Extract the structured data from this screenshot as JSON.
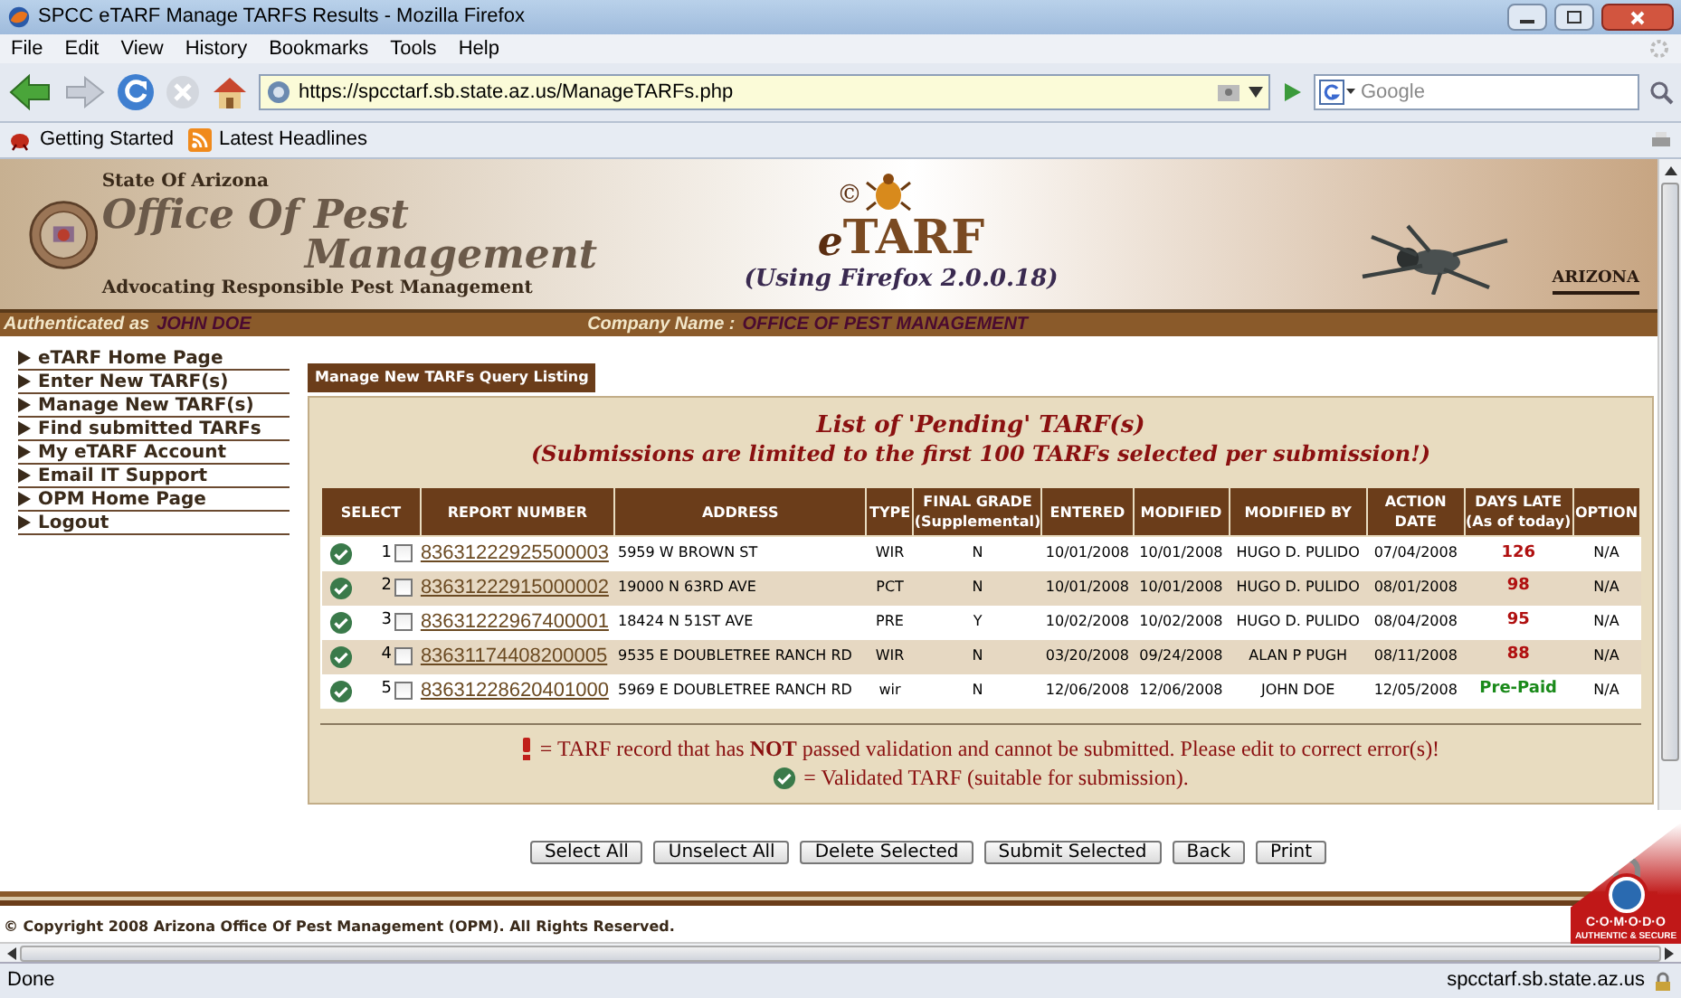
{
  "window": {
    "title": "SPCC eTARF Manage TARFS Results - Mozilla Firefox"
  },
  "menu": [
    "File",
    "Edit",
    "View",
    "History",
    "Bookmarks",
    "Tools",
    "Help"
  ],
  "address_bar": {
    "url": "https://spcctarf.sb.state.az.us/ManageTARFs.php"
  },
  "search": {
    "placeholder": "Google"
  },
  "bookmarks": [
    {
      "label": "Getting Started",
      "kind": "bug"
    },
    {
      "label": "Latest Headlines",
      "kind": "feed"
    }
  ],
  "banner": {
    "state": "State Of Arizona",
    "office_line1": "Office Of Pest",
    "office_line2": "Management",
    "motto": "Advocating Responsible Pest Management",
    "logo_mark": "©",
    "logo_e": "e",
    "logo_name": "TARF",
    "browser_note": "(Using Firefox 2.0.0.18)",
    "seal_badge": "ARIZONA"
  },
  "auth_bar": {
    "label": "Authenticated as",
    "user": "JOHN DOE",
    "company_label": "Company Name :",
    "company": "OFFICE OF PEST MANAGEMENT"
  },
  "sidebar": {
    "items": [
      {
        "label": "eTARF Home Page"
      },
      {
        "label": "Enter New TARF(s)"
      },
      {
        "label": "Manage New TARF(s)"
      },
      {
        "label": "Find submitted TARFs"
      },
      {
        "label": "My eTARF Account"
      },
      {
        "label": "Email IT Support"
      },
      {
        "label": "OPM Home Page"
      },
      {
        "label": "Logout"
      }
    ]
  },
  "panel": {
    "tab": "Manage New TARFs Query Listing",
    "heading": "List of 'Pending' TARF(s)",
    "subheading": "(Submissions are limited to the first 100 TARFs selected per submission!)"
  },
  "table": {
    "columns": [
      [
        "SELECT"
      ],
      [
        "REPORT NUMBER"
      ],
      [
        "ADDRESS"
      ],
      [
        "TYPE"
      ],
      [
        "FINAL GRADE",
        "(Supplemental)"
      ],
      [
        "ENTERED"
      ],
      [
        "MODIFIED"
      ],
      [
        "MODIFIED BY"
      ],
      [
        "ACTION",
        "DATE"
      ],
      [
        "DAYS LATE",
        "(As of today)"
      ],
      [
        "OPTION"
      ]
    ],
    "rows": [
      {
        "valid": true,
        "index": "1",
        "checked": false,
        "report": "83631222925500003",
        "address": "5959 W BROWN ST",
        "type": "WIR",
        "grade": "N",
        "entered": "10/01/2008",
        "modified": "10/01/2008",
        "modified_by": "HUGO D. PULIDO",
        "action_date": "07/04/2008",
        "days_late": "126",
        "color": "#b01010",
        "option": "N/A"
      },
      {
        "valid": true,
        "index": "2",
        "checked": false,
        "report": "83631222915000002",
        "address": "19000 N 63RD AVE",
        "type": "PCT",
        "grade": "N",
        "entered": "10/01/2008",
        "modified": "10/01/2008",
        "modified_by": "HUGO D. PULIDO",
        "action_date": "08/01/2008",
        "days_late": "98",
        "color": "#b01010",
        "option": "N/A"
      },
      {
        "valid": true,
        "index": "3",
        "checked": false,
        "report": "83631222967400001",
        "address": "18424 N 51ST AVE",
        "type": "PRE",
        "grade": "Y",
        "entered": "10/02/2008",
        "modified": "10/02/2008",
        "modified_by": "HUGO D. PULIDO",
        "action_date": "08/04/2008",
        "days_late": "95",
        "color": "#b01010",
        "option": "N/A"
      },
      {
        "valid": true,
        "index": "4",
        "checked": false,
        "report": "83631174408200005",
        "address": "9535 E DOUBLETREE RANCH RD",
        "type": "WIR",
        "grade": "N",
        "entered": "03/20/2008",
        "modified": "09/24/2008",
        "modified_by": "ALAN P PUGH",
        "action_date": "08/11/2008",
        "days_late": "88",
        "color": "#b01010",
        "option": "N/A"
      },
      {
        "valid": true,
        "index": "5",
        "checked": false,
        "report": "83631228620401000",
        "address": "5969 E DOUBLETREE RANCH RD",
        "type": "wir",
        "grade": "N",
        "entered": "12/06/2008",
        "modified": "12/06/2008",
        "modified_by": "JOHN DOE",
        "action_date": "12/05/2008",
        "days_late": "Pre-Paid",
        "color": "#1a8a1a",
        "option": "N/A"
      }
    ]
  },
  "legend": [
    {
      "kind": "error",
      "text": "= TARF record that has **NOT** passed validation and cannot be submitted. Please edit to correct error(s)!"
    },
    {
      "kind": "valid",
      "text": "= Validated TARF (suitable for submission)."
    }
  ],
  "buttons": [
    "Select All",
    "Unselect All",
    "Delete Selected",
    "Submit Selected",
    "Back",
    "Print"
  ],
  "footer": "© Copyright 2008 Arizona Office Of Pest Management (OPM). All Rights Reserved.",
  "secure_badge": {
    "brand": "C·O·M·O·D·O",
    "tagline": "AUTHENTIC & SECURE"
  },
  "status_bar": {
    "text": "Done",
    "host": "spcctarf.sb.state.az.us"
  }
}
